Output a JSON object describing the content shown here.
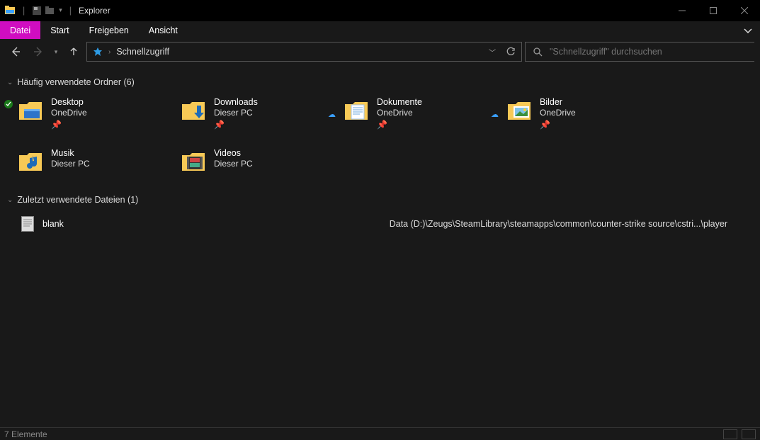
{
  "title": "Explorer",
  "ribbon": {
    "tabs": [
      "Datei",
      "Start",
      "Freigeben",
      "Ansicht"
    ],
    "active": 0
  },
  "breadcrumb": {
    "location": "Schnellzugriff"
  },
  "search": {
    "placeholder": "\"Schnellzugriff\" durchsuchen"
  },
  "sections": {
    "folders_header": "Häufig verwendete Ordner (6)",
    "recent_header": "Zuletzt verwendete Dateien (1)"
  },
  "folders": [
    {
      "name": "Desktop",
      "location": "OneDrive",
      "sync": true,
      "cloud": false,
      "kind": "desktop"
    },
    {
      "name": "Downloads",
      "location": "Dieser PC",
      "sync": false,
      "cloud": false,
      "kind": "downloads"
    },
    {
      "name": "Dokumente",
      "location": "OneDrive",
      "sync": false,
      "cloud": true,
      "kind": "documents"
    },
    {
      "name": "Bilder",
      "location": "OneDrive",
      "sync": false,
      "cloud": true,
      "kind": "pictures"
    },
    {
      "name": "Musik",
      "location": "Dieser PC",
      "sync": false,
      "cloud": false,
      "kind": "music"
    },
    {
      "name": "Videos",
      "location": "Dieser PC",
      "sync": false,
      "cloud": false,
      "kind": "videos"
    }
  ],
  "recent": [
    {
      "name": "blank",
      "path": "Data (D:)\\Zeugs\\SteamLibrary\\steamapps\\common\\counter-strike source\\cstri...\\player"
    }
  ],
  "status": {
    "text": "7 Elemente"
  }
}
